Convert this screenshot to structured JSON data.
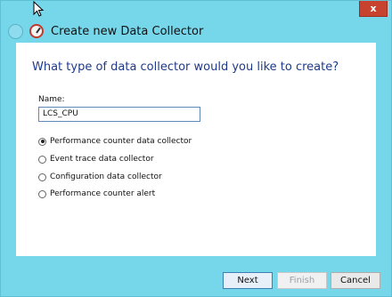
{
  "window": {
    "title": "Create new Data Collector",
    "close_glyph": "x",
    "accent_color": "#76d6ea"
  },
  "wizard": {
    "question": "What type of data collector would you like to create?",
    "name_label": "Name:",
    "name_value": "LCS_CPU",
    "options": [
      {
        "label": "Performance counter data collector",
        "checked": true
      },
      {
        "label": "Event trace data collector",
        "checked": false
      },
      {
        "label": "Configuration data collector",
        "checked": false
      },
      {
        "label": "Performance counter alert",
        "checked": false
      }
    ]
  },
  "buttons": {
    "next": "Next",
    "finish": "Finish",
    "cancel": "Cancel"
  }
}
